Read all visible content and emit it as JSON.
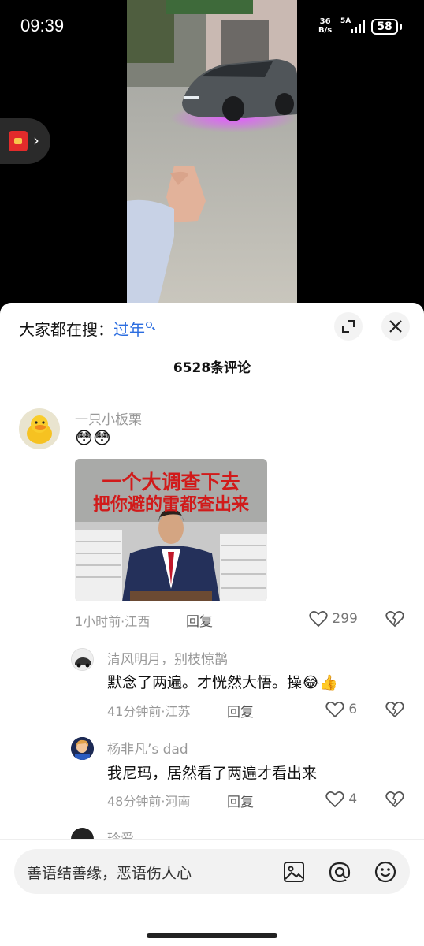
{
  "status_bar": {
    "time": "09:39",
    "net_speed_value": "36",
    "net_speed_unit": "B/s",
    "network": "5A",
    "battery": "58"
  },
  "sheet": {
    "hot_search_label": "大家都在搜：",
    "hot_search_keyword": "过年",
    "comment_count": "6528条评论"
  },
  "comments": [
    {
      "author": "一只小板栗",
      "text": "😳😳",
      "meme_line1": "一个大调查下去",
      "meme_line2": "把你避的雷都查出来",
      "time_location": "1小时前·江西",
      "reply_label": "回复",
      "likes": "299"
    }
  ],
  "replies": [
    {
      "author": "清风明月，别枝惊鹊",
      "text": "默念了两遍。才恍然大悟。操",
      "emoji": "😂👍",
      "time_location": "41分钟前·江苏",
      "reply_label": "回复",
      "likes": "6"
    },
    {
      "author": "杨非凡’s dad",
      "text": "我尼玛，居然看了两遍才看出来",
      "time_location": "48分钟前·河南",
      "reply_label": "回复",
      "likes": "4"
    },
    {
      "author": "玲爱"
    }
  ],
  "input": {
    "placeholder": "善语结善缘，恶语伤人心"
  },
  "colors": {
    "accent": "#2b6de0",
    "meme_text": "#d11a1a"
  },
  "icons": [
    "expand-icon",
    "close-icon",
    "heart-icon",
    "broken-heart-icon",
    "image-icon",
    "at-icon",
    "emoji-icon",
    "red-envelope-icon",
    "chevron-right-icon"
  ]
}
